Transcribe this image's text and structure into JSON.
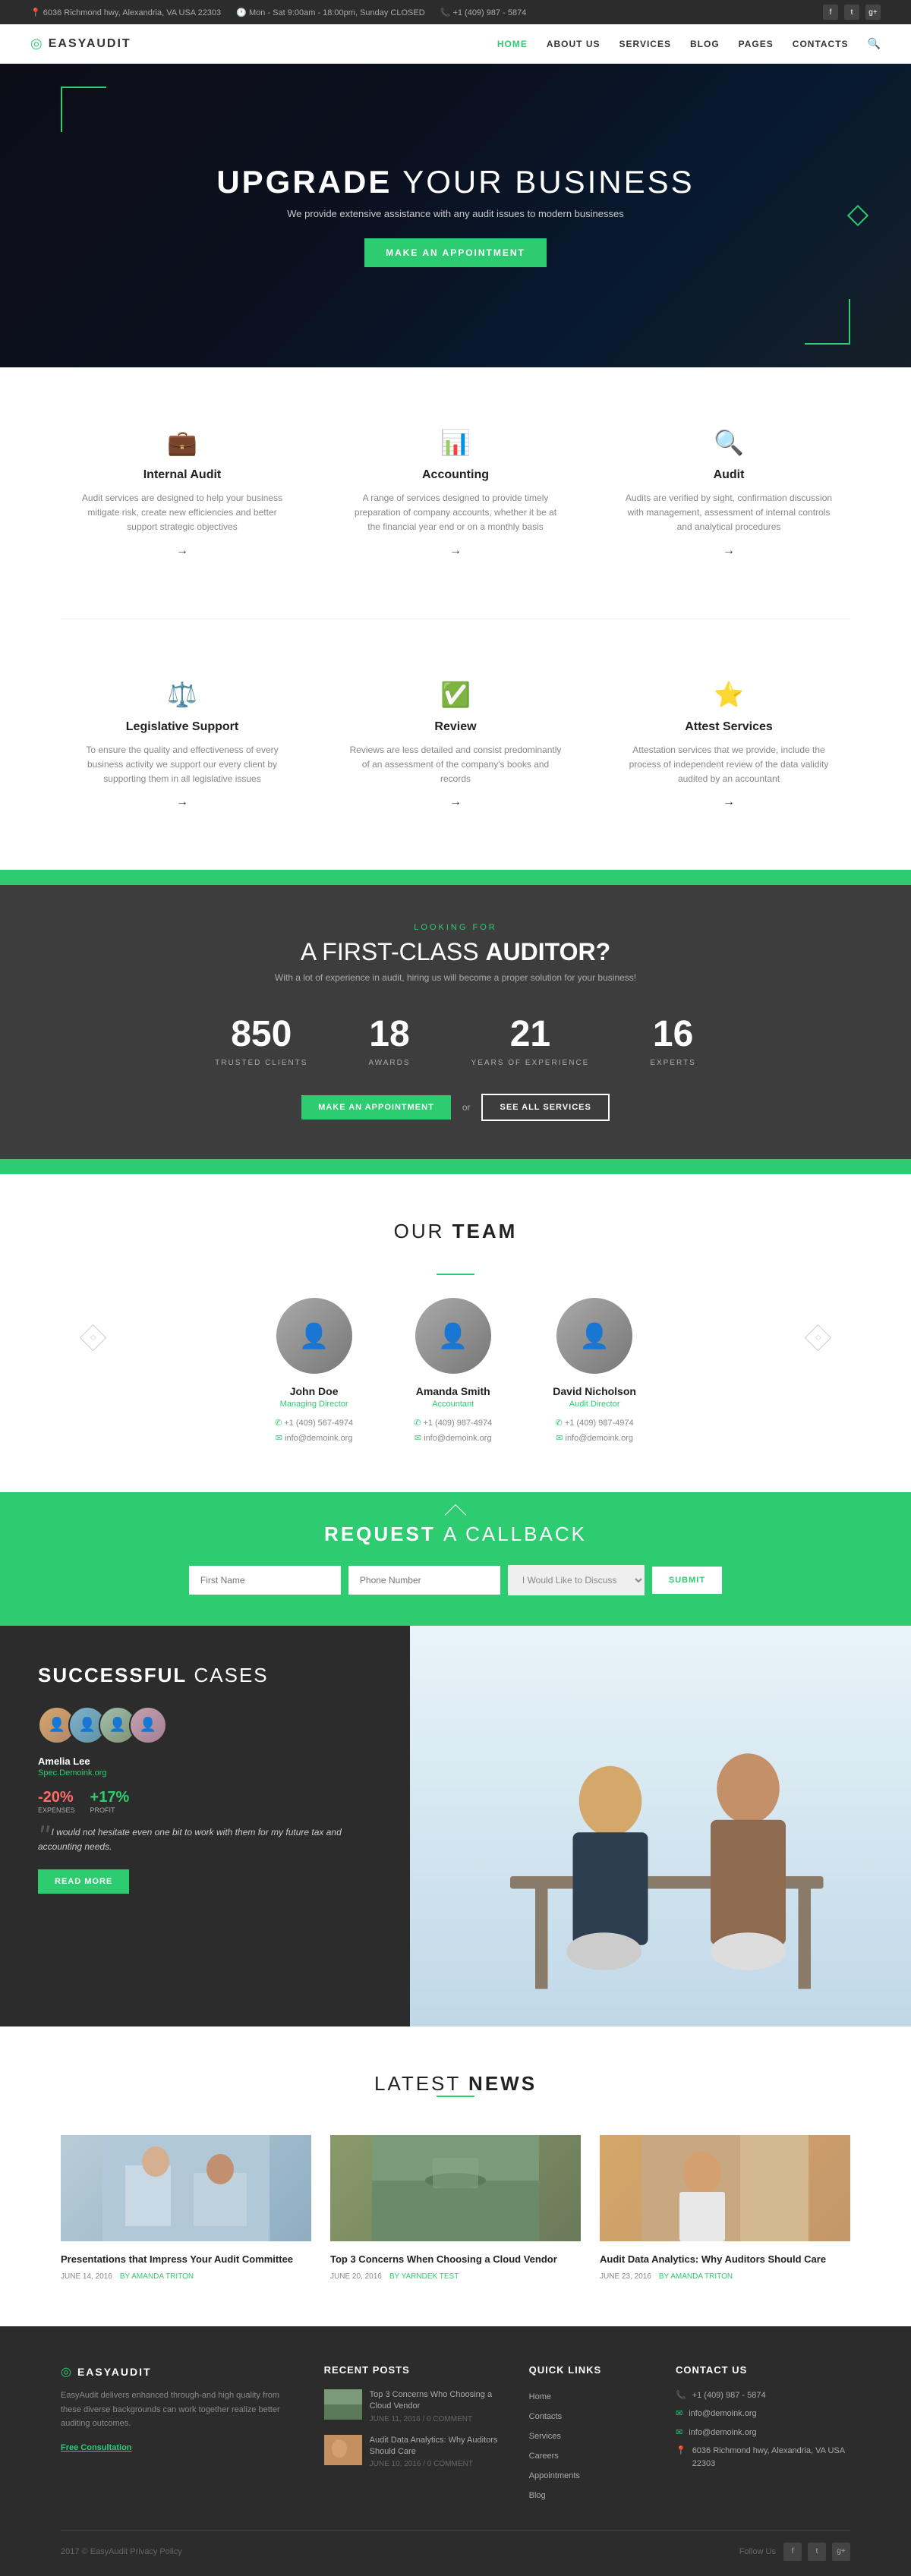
{
  "topbar": {
    "address": "6036 Richmond hwy, Alexandria, VA USA 22303",
    "hours": "Mon - Sat 9:00am - 18:00pm, Sunday CLOSED",
    "phone": "+1 (409) 987 - 5874",
    "social": [
      "f",
      "t",
      "g+"
    ]
  },
  "header": {
    "logo": "EasyAudit",
    "nav": [
      {
        "label": "HOME",
        "active": true
      },
      {
        "label": "ABOUT US"
      },
      {
        "label": "SERVICES"
      },
      {
        "label": "BLOG"
      },
      {
        "label": "PAGES"
      },
      {
        "label": "CONTACTS"
      }
    ]
  },
  "hero": {
    "title_normal": "UPGRADE",
    "title_rest": "YOUR BUSINESS",
    "subtitle": "We provide extensive assistance with any audit issues to modern businesses",
    "cta": "MAKE AN APPOINTMENT"
  },
  "services": {
    "row1": [
      {
        "icon": "💼",
        "title": "Internal Audit",
        "desc": "Audit services are designed to help your business mitigate risk, create new efficiencies and better support strategic objectives",
        "arrow": "→"
      },
      {
        "icon": "📊",
        "title": "Accounting",
        "desc": "A range of services designed to provide timely preparation of company accounts, whether it be at the financial year end or on a monthly basis",
        "arrow": "→"
      },
      {
        "icon": "🔍",
        "title": "Audit",
        "desc": "Audits are verified by sight, confirmation discussion with management, assessment of internal controls and analytical procedures",
        "arrow": "→"
      }
    ],
    "row2": [
      {
        "icon": "⚖️",
        "title": "Legislative Support",
        "desc": "To ensure the quality and effectiveness of every business activity we support our every client by supporting them in all legislative issues",
        "arrow": "→"
      },
      {
        "icon": "✅",
        "title": "Review",
        "desc": "Reviews are less detailed and consist predominantly of an assessment of the company's books and records",
        "arrow": "→"
      },
      {
        "icon": "⭐",
        "title": "Attest Services",
        "desc": "Attestation services that we provide, include the process of independent review of the data validity audited by an accountant",
        "arrow": "→"
      }
    ]
  },
  "stats": {
    "looking_for": "LOOKING FOR",
    "title_normal": "A FIRST-CLASS",
    "title_bold": "AUDITOR?",
    "subtitle": "With a lot of experience in audit, hiring us will become a proper solution for your business!",
    "numbers": [
      {
        "value": "850",
        "label": "TRUSTED CLIENTS"
      },
      {
        "value": "18",
        "label": "AWARDS"
      },
      {
        "value": "21",
        "label": "YEARS OF EXPERIENCE"
      },
      {
        "value": "16",
        "label": "EXPERTS"
      }
    ],
    "btn_primary": "MAKE AN APPOINTMENT",
    "btn_or": "or",
    "btn_secondary": "SEE ALL SERVICES"
  },
  "team": {
    "title_normal": "OUR",
    "title_bold": "TEAM",
    "members": [
      {
        "name": "John Doe",
        "role": "Managing Director",
        "phone": "+1 (409) 567-4974",
        "email": "info@demoink.org"
      },
      {
        "name": "Amanda Smith",
        "role": "Accountant",
        "phone": "+1 (409) 987-4974",
        "email": "info@demoink.org"
      },
      {
        "name": "David Nicholson",
        "role": "Audit Director",
        "phone": "+1 (409) 987-4974",
        "email": "info@demoink.org"
      }
    ]
  },
  "callback": {
    "title_normal": "REQUEST",
    "title_bold": "A CALLBACK",
    "form": {
      "name_placeholder": "First Name",
      "phone_placeholder": "Phone Number",
      "select_placeholder": "I Would Like to Discuss",
      "submit": "SUBMIT"
    }
  },
  "cases": {
    "title_normal": "SUCCESSFUL",
    "title_bold": "CASES",
    "person": {
      "name": "Amelia Lee",
      "site": "Spec.Demoink.org",
      "stat1_label": "EXPENSES",
      "stat1_value": "-20%",
      "stat2_label": "PROFIT",
      "stat2_value": "+17%",
      "quote": "I would not hesitate even one bit to work with them for my future tax and accounting needs.",
      "btn": "READ MORE"
    }
  },
  "news": {
    "title_normal": "LATEST",
    "title_bold": "NEWS",
    "articles": [
      {
        "title": "Presentations that Impress Your Audit Committee",
        "date": "JUNE 14, 2016",
        "author": "BY AMANDA TRITON"
      },
      {
        "title": "Top 3 Concerns When Choosing a Cloud Vendor",
        "date": "JUNE 20, 2016",
        "author": "BY YARNDEK TEST"
      },
      {
        "title": "Audit Data Analytics: Why Auditors Should Care",
        "date": "JUNE 23, 2016",
        "author": "BY AMANDA TRITON"
      }
    ]
  },
  "footer": {
    "logo": "EasyAudit",
    "desc": "EasyAudit delivers enhanced through-and high quality from these diverse backgrounds can work together realize better auditing outcomes.",
    "consultation": "Free Consultation",
    "sections": {
      "recent_posts": {
        "title": "RECENT POSTS",
        "posts": [
          {
            "title": "Top 3 Concerns Who Choosing a Cloud Vendor",
            "date": "JUNE 11, 2016 / 0 COMMENT"
          },
          {
            "title": "Audit Data Analytics: Why Auditors Should Care",
            "date": "JUNE 10, 2016 / 0 COMMENT"
          }
        ]
      },
      "quick_links": {
        "title": "QUICK LINKS",
        "links": [
          "Home",
          "Contacts",
          "Services",
          "Careers",
          "Appointments",
          "Blog"
        ]
      },
      "contact": {
        "title": "CONTACT US",
        "phone": "+1 (409) 987 - 5874",
        "email": "info@demoink.org",
        "email2": "info@demoink.org",
        "address": "6036 Richmond hwy, Alexandria, VA USA 22303"
      }
    },
    "about_links": [
      "Home",
      "Contacts",
      "Services",
      "Careers",
      "Appointments",
      "Blog"
    ],
    "copyright": "2017 © EasyAudit   Privacy Policy",
    "follow": "Follow Us",
    "social": [
      "f",
      "t",
      "g+"
    ]
  }
}
